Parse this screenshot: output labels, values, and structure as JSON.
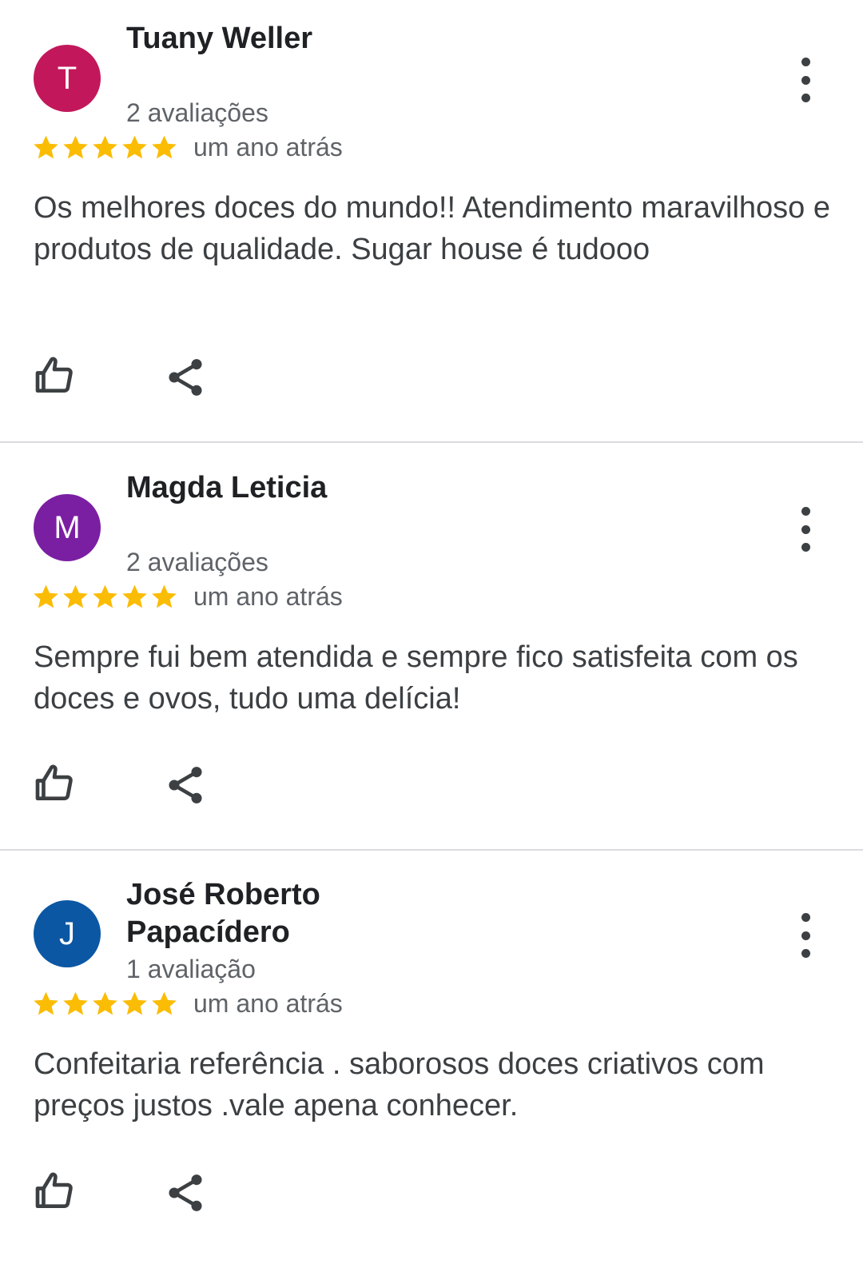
{
  "colors": {
    "star": "#fbbc04",
    "text": "#3c4043",
    "secondary_text": "#5f6368",
    "divider": "#dadce0"
  },
  "icons": {
    "more": "more-vert-icon",
    "like": "thumb-up-icon",
    "share": "share-icon",
    "star": "star-icon"
  },
  "reviews": [
    {
      "initial": "T",
      "avatar_color": "#c2185b",
      "name": "Tuany Weller",
      "review_count": "2 avaliações",
      "rating": 5,
      "date": "um ano atrás",
      "text": "Os melhores doces do mundo!! Atendimento maravilhoso e produtos de qualidade. Sugar house é tudooo"
    },
    {
      "initial": "M",
      "avatar_color": "#7b1fa2",
      "name": "Magda Leticia",
      "review_count": "2 avaliações",
      "rating": 5,
      "date": "um ano atrás",
      "text": "Sempre fui bem atendida e sempre fico satisfeita com os doces e ovos, tudo uma delícia!"
    },
    {
      "initial": "J",
      "avatar_color": "#0b57a4",
      "name": "José Roberto Papacídero",
      "review_count": "1 avaliação",
      "rating": 5,
      "date": "um ano atrás",
      "text": "Confeitaria referência . saborosos doces criativos com preços justos .vale apena conhecer."
    }
  ]
}
